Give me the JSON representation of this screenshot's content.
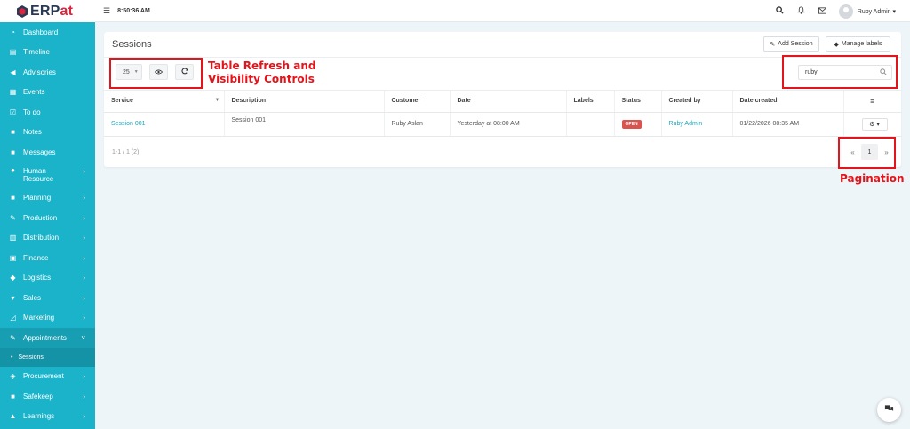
{
  "app": {
    "logo_prefix": "ERP",
    "logo_suffix": "at",
    "logo_accent": "#d7263d"
  },
  "topbar": {
    "menu_icon": "menu-icon",
    "time": "8:50:36 AM",
    "user_name": "Ruby Admin",
    "user_caret": "▾"
  },
  "sidebar": {
    "items": [
      {
        "label": "Dashboard",
        "icon": "dashboard-icon",
        "glyph": "◔",
        "chev": ""
      },
      {
        "label": "Timeline",
        "icon": "timeline-icon",
        "glyph": "▤",
        "chev": ""
      },
      {
        "label": "Advisories",
        "icon": "megaphone-icon",
        "glyph": "◀",
        "chev": ""
      },
      {
        "label": "Events",
        "icon": "calendar-icon",
        "glyph": "▦",
        "chev": ""
      },
      {
        "label": "To do",
        "icon": "checkbox-icon",
        "glyph": "☑",
        "chev": ""
      },
      {
        "label": "Notes",
        "icon": "notes-icon",
        "glyph": "■",
        "chev": ""
      },
      {
        "label": "Messages",
        "icon": "messages-icon",
        "glyph": "■",
        "chev": ""
      },
      {
        "label": "Human Resource",
        "icon": "users-icon",
        "glyph": "●",
        "chev": "›"
      },
      {
        "label": "Planning",
        "icon": "briefcase-icon",
        "glyph": "■",
        "chev": "›"
      },
      {
        "label": "Production",
        "icon": "production-icon",
        "glyph": "✎",
        "chev": "›"
      },
      {
        "label": "Distribution",
        "icon": "bank-icon",
        "glyph": "▥",
        "chev": "›"
      },
      {
        "label": "Finance",
        "icon": "money-icon",
        "glyph": "▣",
        "chev": "›"
      },
      {
        "label": "Logistics",
        "icon": "tag-icon",
        "glyph": "◆",
        "chev": "›"
      },
      {
        "label": "Sales",
        "icon": "cart-icon",
        "glyph": "▾",
        "chev": "›"
      },
      {
        "label": "Marketing",
        "icon": "chart-icon",
        "glyph": "◿",
        "chev": "›"
      },
      {
        "label": "Appointments",
        "icon": "edit-icon",
        "glyph": "✎",
        "chev": "˅"
      },
      {
        "label": "Procurement",
        "icon": "cubes-icon",
        "glyph": "◈",
        "chev": "›"
      },
      {
        "label": "Safekeep",
        "icon": "safe-icon",
        "glyph": "■",
        "chev": "›"
      },
      {
        "label": "Learnings",
        "icon": "graduation-icon",
        "glyph": "▲",
        "chev": "›"
      }
    ],
    "sub_item": "Sessions"
  },
  "page": {
    "title": "Sessions",
    "add_button": "Add Session",
    "labels_button": "Manage labels",
    "page_size": "25",
    "search_value": "ruby",
    "columns": [
      "Service",
      "Description",
      "Customer",
      "Date",
      "Labels",
      "Status",
      "Created by",
      "Date created",
      "≡"
    ],
    "rows": [
      {
        "service": "Session 001",
        "description": "Session 001",
        "customer": "Ruby Aslan",
        "date": "Yesterday at 08:00 AM",
        "labels": "",
        "status": "OPEN",
        "created_by": "Ruby Admin",
        "date_created": "01/22/2026 08:35 AM"
      }
    ],
    "footer_info": "1-1 / 1 (2)",
    "pagination": {
      "prev": "«",
      "current": "1",
      "next": "»"
    }
  },
  "annotations": {
    "table_controls": "Table Refresh and Visibility Controls",
    "pagination": "Pagination",
    "color": "#e3141b"
  }
}
